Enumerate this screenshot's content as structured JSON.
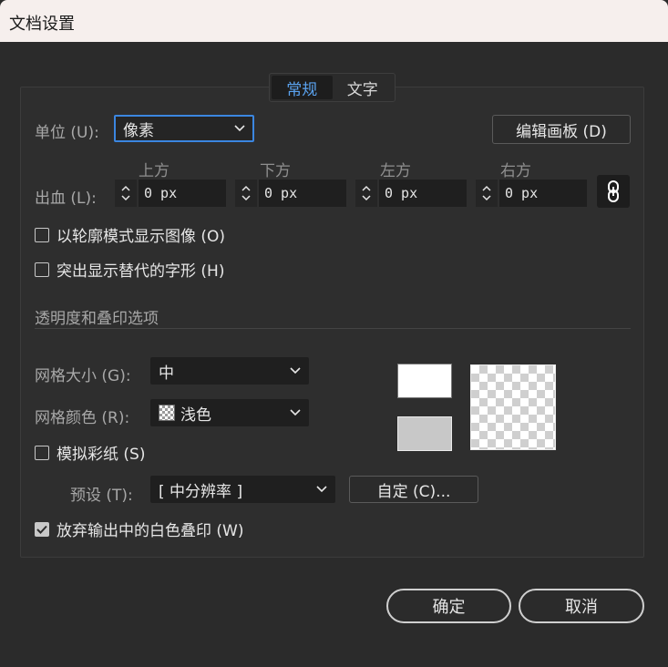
{
  "window": {
    "title": "文档设置"
  },
  "tabs": [
    {
      "label": "常规",
      "active": true
    },
    {
      "label": "文字",
      "active": false
    }
  ],
  "units": {
    "label": "单位 (U):",
    "value": "像素"
  },
  "edit_artboard_button": "编辑画板 (D)",
  "bleed": {
    "label": "出血 (L):",
    "sides": [
      {
        "header": "上方",
        "value": "0 px"
      },
      {
        "header": "下方",
        "value": "0 px"
      },
      {
        "header": "左方",
        "value": "0 px"
      },
      {
        "header": "右方",
        "value": "0 px"
      }
    ]
  },
  "options": {
    "outline_mode": {
      "label": "以轮廓模式显示图像 (O)",
      "checked": false
    },
    "highlight_glyphs": {
      "label": "突出显示替代的字形 (H)",
      "checked": false
    }
  },
  "transparency": {
    "section_title": "透明度和叠印选项",
    "grid_size": {
      "label": "网格大小 (G):",
      "value": "中"
    },
    "grid_color": {
      "label": "网格颜色 (R):",
      "value": "浅色"
    },
    "simulate_paper": {
      "label": "模拟彩纸 (S)",
      "checked": false
    },
    "preset": {
      "label": "预设 (T):",
      "value": "[ 中分辨率 ]"
    },
    "custom_button": "自定 (C)...",
    "discard_white_overprint": {
      "label": "放弃输出中的白色叠印 (W)",
      "checked": true
    }
  },
  "footer": {
    "ok": "确定",
    "cancel": "取消"
  },
  "colors": {
    "accent": "#3b86e0",
    "active_tab_text": "#5aa3f0"
  }
}
